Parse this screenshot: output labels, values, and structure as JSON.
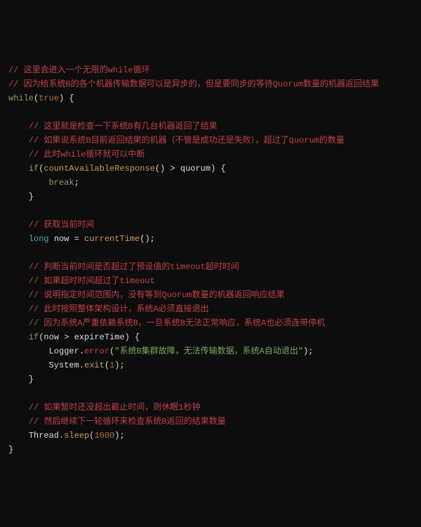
{
  "code": {
    "l1_cm": "// 这里会进入一个无限的while循环",
    "l2_cm": "// 因为给系统B的各个机器传输数据可以是异步的，但是要同步的等待Quorum数量的机器返回结果",
    "l3_kw_while": "while",
    "l3_bool": "true",
    "l3_rest": ") {",
    "l5_cm": "    // 这里就是检查一下系统B有几台机器返回了结果",
    "l6_cm": "    // 如果说系统B目前返回结果的机器（不管是成功还是失败），超过了quorum的数量",
    "l7_cm": "    // 此时while循环就可以中断",
    "l8_kw_if": "if",
    "l8_fn": "countAvailableResponse",
    "l8_mid": "() > ",
    "l8_id": "quorum",
    "l8_end": ") {",
    "l9_kw_break": "break",
    "l10_brace": "    }",
    "l12_cm": "    // 获取当前时间",
    "l13_ty": "long",
    "l13_id": " now = ",
    "l13_fn": "currentTime",
    "l13_end": "();",
    "l15_cm": "    // 判断当前时间是否超过了预设值的timeout超时时间",
    "l16_cm": "    // 如果超时时间超过了timeout",
    "l17_cm": "    // 说明指定时间范围内，没有等到Quorum数量的机器返回响应结果",
    "l18_cm": "    // 此时按照整体架构设计，系统A必须直接退出",
    "l19_cm": "    // 因为系统A严重依赖系统B，一旦系统B无法正常响应，系统A也必须连带停机",
    "l20_kw_if": "if",
    "l20_args": "(now > expireTime) {",
    "l21_obj": "Logger",
    "l21_dot": ".",
    "l21_err": "error",
    "l21_open": "(",
    "l21_str": "\"系统B集群故障，无法传输数据，系统A自动退出\"",
    "l21_close": ");",
    "l22_obj": "System",
    "l22_dot": ".",
    "l22_fn": "exit",
    "l22_open": "(",
    "l22_num": "1",
    "l22_close": ");",
    "l23_brace": "    }",
    "l25_cm": "    // 如果暂时还没超出截止时间，则休眠1秒钟",
    "l26_cm": "    // 然后继续下一轮循环来检查系统B返回的结果数量",
    "l27_obj": "Thread",
    "l27_dot": ".",
    "l27_fn": "sleep",
    "l27_open": "(",
    "l27_num": "1000",
    "l27_close": ");",
    "l28_brace": "}"
  }
}
